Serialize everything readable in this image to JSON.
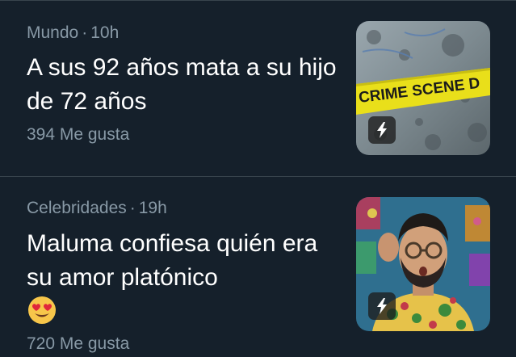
{
  "stories": [
    {
      "category": "Mundo",
      "separator": "·",
      "time": "10h",
      "headline": "A sus 92 años mata a su hijo de 72 años",
      "likes": "394 Me gusta",
      "thumbnail_icon": "crime-scene-photo",
      "thumbnail_text": "CRIME SCENE D",
      "badge_icon": "lightning-bolt-icon"
    },
    {
      "category": "Celebridades",
      "separator": "·",
      "time": "19h",
      "headline": "Maluma confiesa quién era su amor platónico",
      "emoji": "heart-eyes-emoji",
      "likes": "720 Me gusta",
      "thumbnail_icon": "person-portrait-photo",
      "badge_icon": "lightning-bolt-icon"
    }
  ],
  "colors": {
    "background": "#15202b",
    "divider": "#38444d",
    "secondary_text": "#8899a6",
    "primary_text": "#ffffff"
  }
}
